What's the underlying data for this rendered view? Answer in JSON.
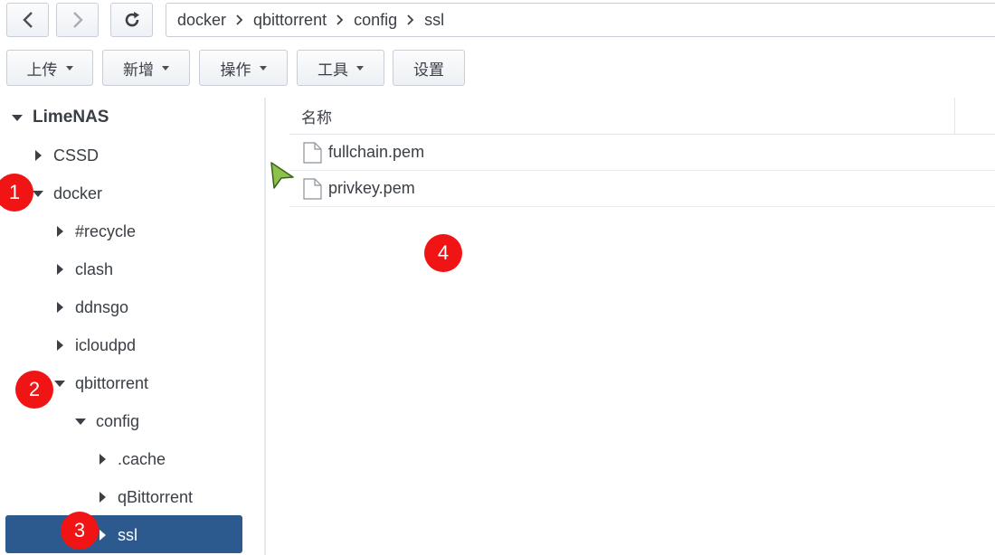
{
  "nav": {
    "back_icon": "chevron-left-icon",
    "forward_icon": "chevron-right-icon",
    "refresh_icon": "refresh-icon"
  },
  "path": {
    "crumbs": [
      "docker",
      "qbittorrent",
      "config",
      "ssl"
    ]
  },
  "toolbar": {
    "upload_label": "上传",
    "new_label": "新增",
    "action_label": "操作",
    "tools_label": "工具",
    "settings_label": "设置"
  },
  "tree": {
    "root": "LimeNAS",
    "items": [
      {
        "label": "CSSD",
        "state": "collapsed"
      },
      {
        "label": "docker",
        "state": "expanded"
      },
      {
        "label": "#recycle",
        "state": "collapsed"
      },
      {
        "label": "clash",
        "state": "collapsed"
      },
      {
        "label": "ddnsgo",
        "state": "collapsed"
      },
      {
        "label": "icloudpd",
        "state": "collapsed"
      },
      {
        "label": "qbittorrent",
        "state": "expanded"
      },
      {
        "label": "config",
        "state": "expanded"
      },
      {
        "label": ".cache",
        "state": "collapsed"
      },
      {
        "label": "qBittorrent",
        "state": "collapsed"
      },
      {
        "label": "ssl",
        "state": "selected"
      }
    ]
  },
  "list": {
    "name_header": "名称",
    "files": [
      "fullchain.pem",
      "privkey.pem"
    ]
  },
  "markers": [
    "1",
    "2",
    "3",
    "4"
  ],
  "colors": {
    "selection": "#2c5a8f",
    "marker": "#f01414",
    "cursor": "#8bc34a"
  }
}
